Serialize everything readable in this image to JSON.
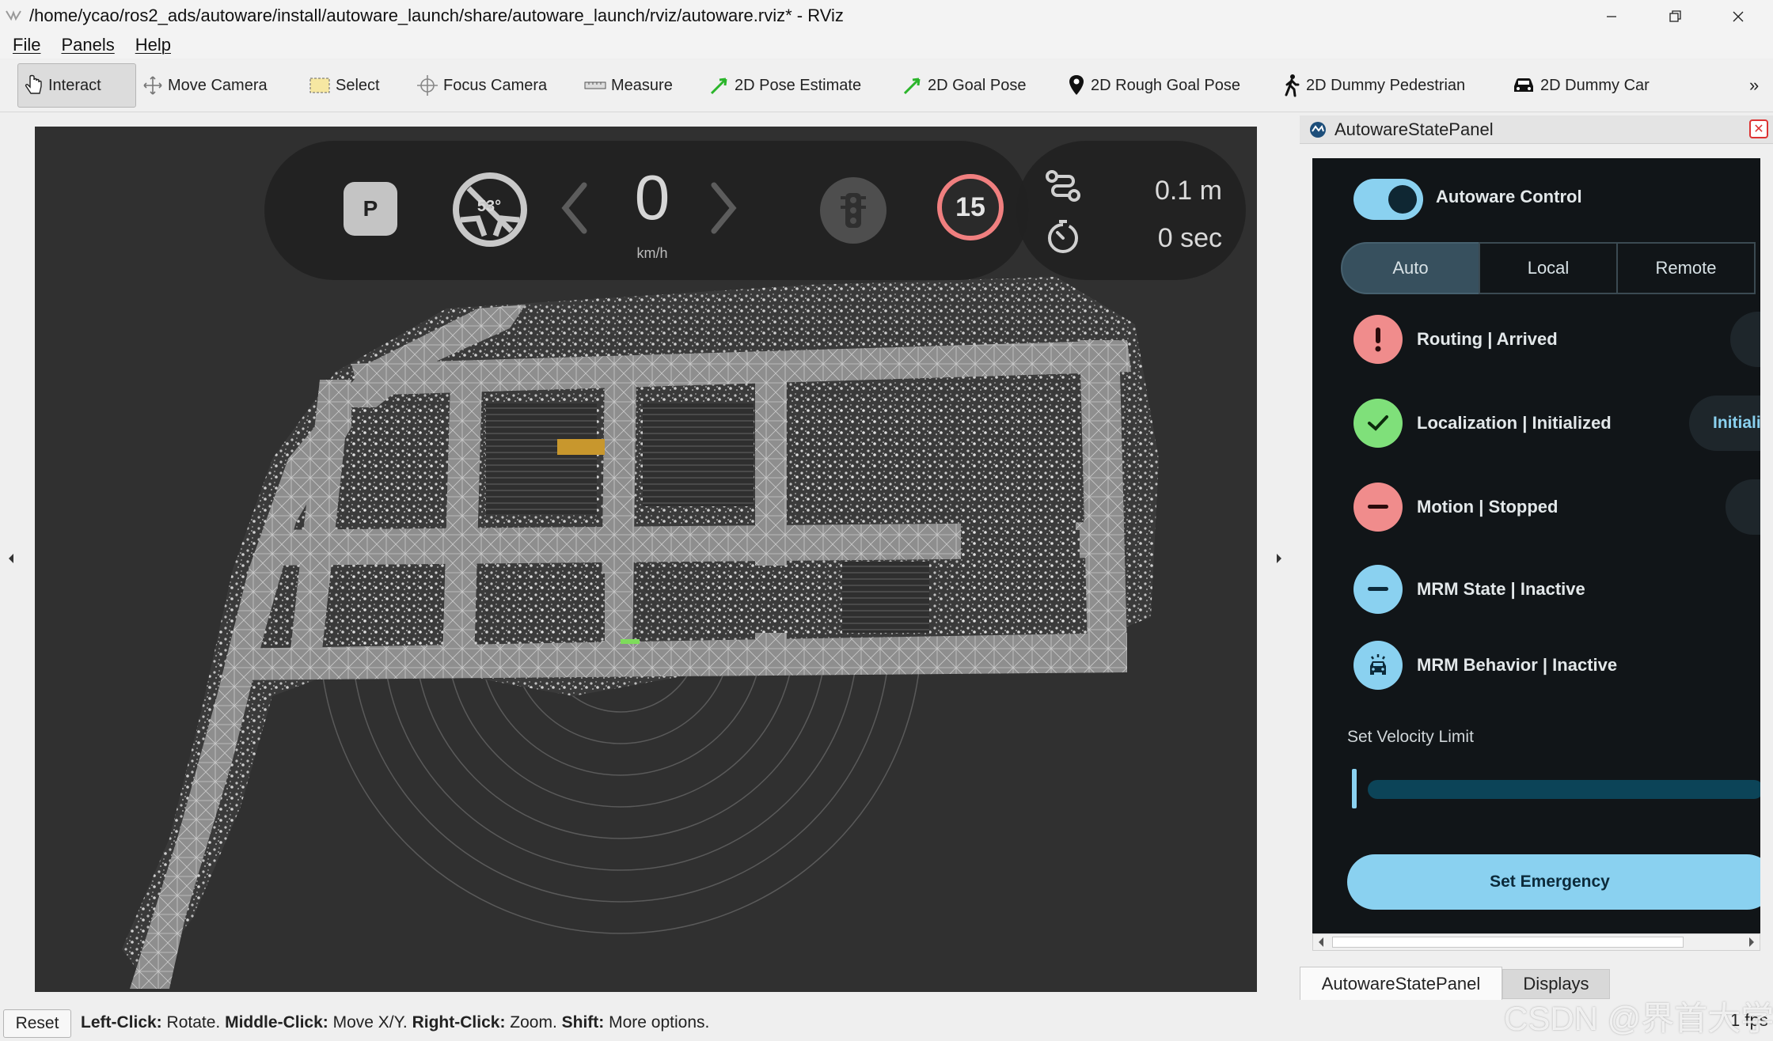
{
  "window": {
    "title": "/home/ycao/ros2_ads/autoware/install/autoware_launch/share/autoware_launch/rviz/autoware.rviz* - RViz",
    "controls": [
      "minimize-icon",
      "maximize-icon",
      "close-icon"
    ]
  },
  "menu": [
    "File",
    "Panels",
    "Help"
  ],
  "toolbar": {
    "interact": "Interact",
    "move_camera": "Move Camera",
    "select": "Select",
    "focus_camera": "Focus Camera",
    "measure": "Measure",
    "pose_estimate": "2D Pose Estimate",
    "goal_pose": "2D Goal Pose",
    "rough_goal_pose": "2D Rough Goal Pose",
    "dummy_pedestrian": "2D Dummy Pedestrian",
    "dummy_car": "2D Dummy Car",
    "more": "»"
  },
  "hud": {
    "gear": "P",
    "steering_angle": "53°",
    "speed": "0",
    "speed_unit": "km/h",
    "speed_limit": "15",
    "distance": "0.1 m",
    "time": "0 sec"
  },
  "panel": {
    "title": "AutowareStatePanel",
    "control_label": "Autoware Control",
    "control_enabled": true,
    "modes": [
      "Auto",
      "Local",
      "Remote"
    ],
    "active_mode": "Auto",
    "statuses": {
      "routing": "Routing | Arrived",
      "localization": "Localization | Initialized",
      "motion": "Motion | Stopped",
      "mrm_state": "MRM State | Inactive",
      "mrm_behavior": "MRM Behavior | Inactive"
    },
    "localization_button": "Initialize",
    "velocity_title": "Set Velocity Limit",
    "emergency_button": "Set Emergency",
    "colors": {
      "accent": "#8ad1f0",
      "error": "#f08c8c",
      "ok": "#7fe07a",
      "info": "#8ad1f0"
    }
  },
  "tabs": [
    "AutowareStatePanel",
    "Displays"
  ],
  "statusbar": {
    "reset": "Reset",
    "help": {
      "left_key": "Left-Click:",
      "left_val": " Rotate. ",
      "middle_key": "Middle-Click:",
      "middle_val": " Move X/Y. ",
      "right_key": "Right-Click:",
      "right_val": " Zoom. ",
      "shift_key": "Shift:",
      "shift_val": " More options."
    },
    "fps": "1 fps"
  },
  "watermark": "CSDN @界首大学"
}
